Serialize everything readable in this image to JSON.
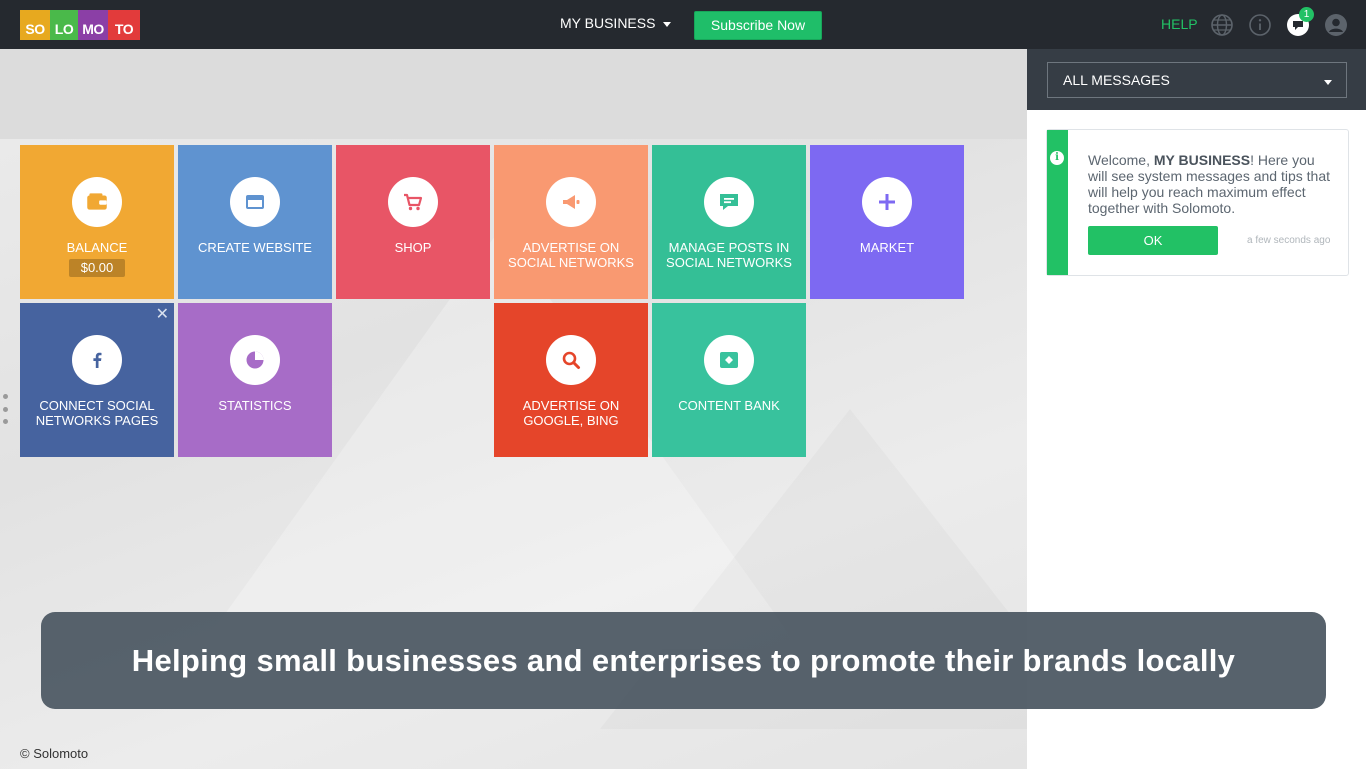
{
  "logo": {
    "letters": [
      "SO",
      "LO",
      "MO",
      "TO"
    ],
    "colors": [
      "#e7a91f",
      "#4ab94a",
      "#8b3fa6",
      "#e23b3b"
    ]
  },
  "header": {
    "business_label": "MY BUSINESS",
    "subscribe_label": "Subscribe Now",
    "help_label": "HELP",
    "icons": [
      "globe-icon",
      "info-icon",
      "chat-icon",
      "user-icon"
    ],
    "notification_count": "1"
  },
  "tiles": [
    {
      "label": "BALANCE",
      "balance": "$0.00",
      "color": "#f1a833",
      "icon": "wallet-icon"
    },
    {
      "label": "CREATE WEBSITE",
      "color": "#5f93d0",
      "icon": "browser-window-icon"
    },
    {
      "label": "SHOP",
      "color": "#e85566",
      "icon": "cart-icon"
    },
    {
      "label": "ADVERTISE ON SOCIAL NETWORKS",
      "color": "#f99971",
      "icon": "megaphone-icon"
    },
    {
      "label": "MANAGE POSTS IN SOCIAL NETWORKS",
      "color": "#34bf96",
      "icon": "message-icon"
    },
    {
      "label": "MARKET",
      "color": "#7d69f2",
      "icon": "plus-icon"
    },
    {
      "label": "CONNECT SOCIAL NETWORKS PAGES",
      "color": "#46639f",
      "icon": "facebook-icon"
    },
    {
      "label": "STATISTICS",
      "color": "#a76cc7",
      "icon": "pie-chart-icon"
    },
    {
      "label": "ADVERTISE ON GOOGLE, BING",
      "color": "#e5452a",
      "icon": "search-icon"
    },
    {
      "label": "CONTENT BANK",
      "color": "#38c29d",
      "icon": "image-icon"
    }
  ],
  "caption": "Helping small businesses and enterprises to promote their brands locally",
  "footer": "© Solomoto",
  "panel": {
    "filter_label": "ALL MESSAGES",
    "message": {
      "prefix": "Welcome, ",
      "business": "MY BUSINESS",
      "suffix": "! Here you will see system messages and tips that will help you reach maximum effect together with Solomoto.",
      "ok_label": "OK",
      "time": "a few seconds ago"
    }
  }
}
